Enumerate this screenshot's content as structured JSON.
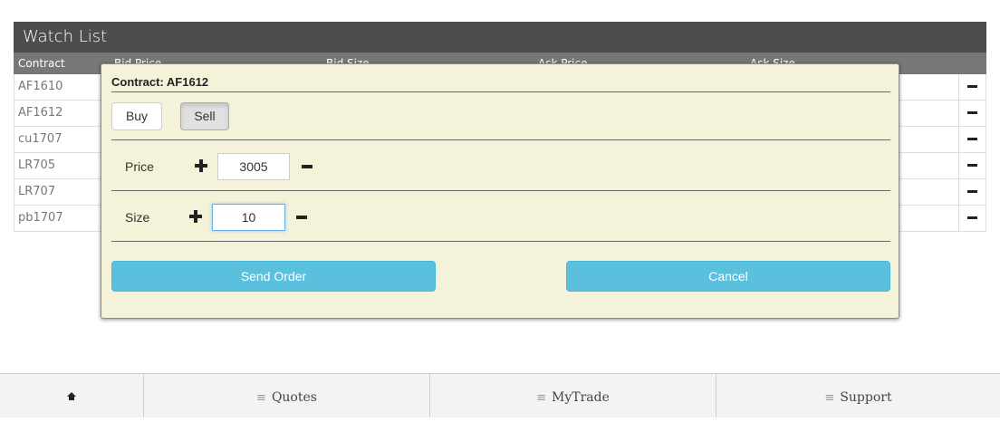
{
  "watchlist": {
    "title": "Watch List",
    "columns": [
      "Contract",
      "Bid Price",
      "Bid Size",
      "Ask Price",
      "Ask Size"
    ],
    "rows": [
      {
        "contract": "AF1610"
      },
      {
        "contract": "AF1612"
      },
      {
        "contract": "cu1707"
      },
      {
        "contract": "LR705"
      },
      {
        "contract": "LR707"
      },
      {
        "contract": "pb1707"
      }
    ]
  },
  "order_dialog": {
    "title": "Contract: AF1612",
    "buy_label": "Buy",
    "sell_label": "Sell",
    "selected_side": "Sell",
    "price_label": "Price",
    "price_value": "3005",
    "size_label": "Size",
    "size_value": "10",
    "send_label": "Send Order",
    "cancel_label": "Cancel",
    "accent_color": "#5bc0de",
    "background_color": "#f4f3d9"
  },
  "bottom_nav": {
    "home_icon": "home-icon",
    "menu_icon": "hamburger-icon",
    "items": [
      "Quotes",
      "MyTrade",
      "Support"
    ]
  }
}
